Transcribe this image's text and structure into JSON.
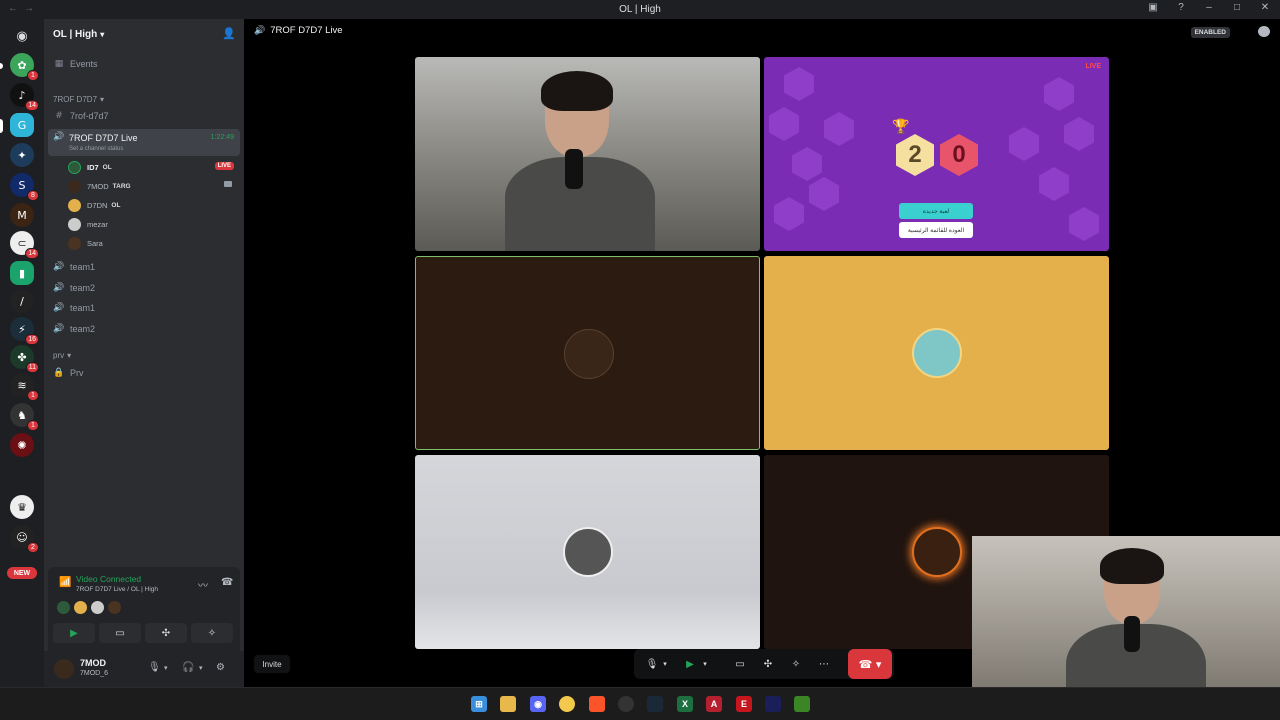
{
  "window": {
    "title": "OL | High"
  },
  "server": {
    "name": "OL | High",
    "events_label": "Events"
  },
  "categories": [
    {
      "label": "7ROF D7D7"
    },
    {
      "label": "prv"
    }
  ],
  "channels": {
    "text": "7rof-d7d7",
    "live": {
      "name": "7ROF D7D7 Live",
      "status": "Set a channel status",
      "timer": "1:22:49"
    },
    "voice_others": [
      "team1",
      "team2",
      "team1",
      "team2"
    ],
    "private": "Prv"
  },
  "voice_users": [
    {
      "name": "ID7",
      "tag": "OL",
      "live": "LIVE"
    },
    {
      "name": "7MOD",
      "tag": "TARG"
    },
    {
      "name": "D7DN",
      "tag": "OL"
    },
    {
      "name": "mezar"
    },
    {
      "name": "Sara"
    }
  ],
  "guild_badges": [
    "1",
    "14",
    "8",
    "14",
    "16",
    "11",
    "1",
    "1",
    "2"
  ],
  "guild_new": "NEW",
  "rtc": {
    "status": "Video Connected",
    "channel": "7ROF D7D7 Live / OL | High"
  },
  "user": {
    "name": "7MOD",
    "sub": "7MOD_6"
  },
  "stage": {
    "title": "7ROF D7D7 Live",
    "enabled": "ENABLED",
    "invite": "Invite"
  },
  "game": {
    "score_left": "2",
    "score_right": "0",
    "btn_primary": "لعبة جديدة",
    "btn_secondary": "العودة للقائمة الرئيسية",
    "live": "LIVE"
  },
  "colors": {
    "accent_green": "#23a55a",
    "danger": "#da373c",
    "game_purple": "#7b2cb4",
    "tile_yellow": "#e3b04b"
  }
}
